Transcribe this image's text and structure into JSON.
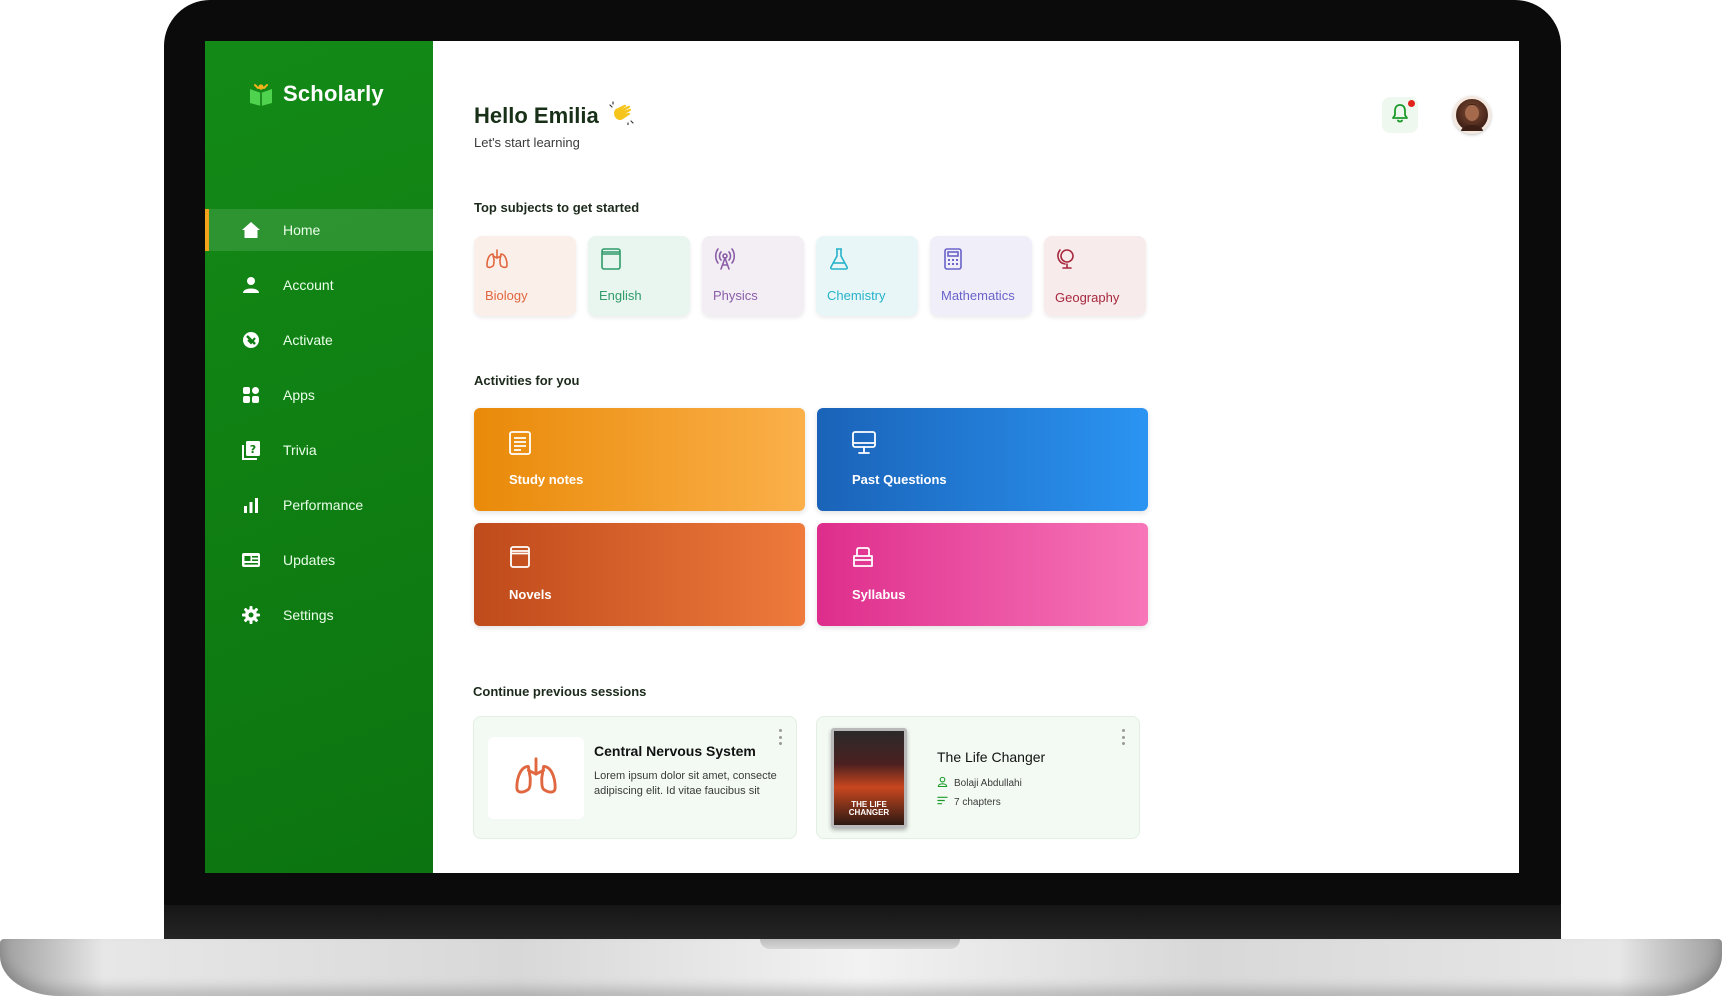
{
  "app": {
    "name": "Scholarly"
  },
  "sidebar": {
    "items": [
      {
        "label": "Home",
        "icon": "home-icon",
        "active": true
      },
      {
        "label": "Account",
        "icon": "user-icon"
      },
      {
        "label": "Activate",
        "icon": "activate-icon"
      },
      {
        "label": "Apps",
        "icon": "apps-grid-icon"
      },
      {
        "label": "Trivia",
        "icon": "trivia-icon"
      },
      {
        "label": "Performance",
        "icon": "bar-chart-icon"
      },
      {
        "label": "Updates",
        "icon": "news-icon"
      },
      {
        "label": "Settings",
        "icon": "gear-icon"
      }
    ]
  },
  "header": {
    "greeting": "Hello Emilia",
    "greeting_icon": "waving-hand-icon",
    "subtitle": "Let's start learning",
    "has_notification": true
  },
  "subjects": {
    "title": "Top subjects to get started",
    "items": [
      {
        "label": "Biology",
        "icon": "lungs-icon",
        "color": "#e0673f",
        "bg": "#fbefe9"
      },
      {
        "label": "English",
        "icon": "book-icon",
        "color": "#2f9c6a",
        "bg": "#e9f5ef"
      },
      {
        "label": "Physics",
        "icon": "antenna-icon",
        "color": "#8a5ea8",
        "bg": "#f3eef4"
      },
      {
        "label": "Chemistry",
        "icon": "flask-icon",
        "color": "#26b3c9",
        "bg": "#e8f6f8"
      },
      {
        "label": "Mathematics",
        "icon": "calculator-icon",
        "color": "#6a63c9",
        "bg": "#efeef9"
      },
      {
        "label": "Geography",
        "icon": "globe-icon",
        "color": "#a8283e",
        "bg": "#f7eceb"
      }
    ]
  },
  "activities": {
    "title": "Activities for you",
    "items": [
      {
        "label": "Study notes",
        "icon": "notes-icon",
        "from": "#e98a09",
        "to": "#fbb04a"
      },
      {
        "label": "Past Questions",
        "icon": "monitor-icon",
        "from": "#1a63b8",
        "to": "#2b94f2"
      },
      {
        "label": "Novels",
        "icon": "novel-icon",
        "from": "#bf4a1b",
        "to": "#ef7a3c"
      },
      {
        "label": "Syllabus",
        "icon": "syllabus-icon",
        "from": "#de2d8c",
        "to": "#f776b8"
      }
    ]
  },
  "sessions": {
    "title": "Continue previous sessions",
    "items": [
      {
        "title": "Central Nervous System",
        "description": "Lorem ipsum dolor sit amet, consecte adipiscing elit. Id vitae faucibus sit",
        "icon": "lungs-icon"
      },
      {
        "title": "The Life Changer",
        "author": "Bolaji Abdullahi",
        "chapters": "7 chapters",
        "cover_text": "THE LIFE CHANGER"
      }
    ]
  }
}
